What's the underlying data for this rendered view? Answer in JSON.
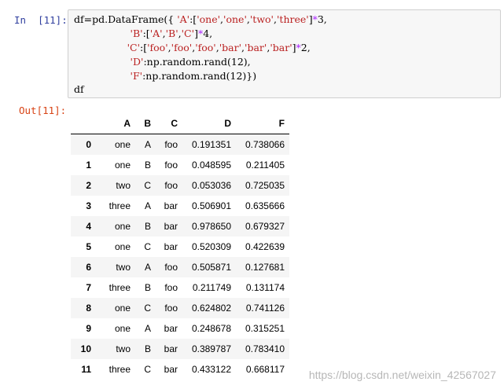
{
  "cell": {
    "in_prompt": "In  [11]:",
    "out_prompt": "Out[11]:",
    "code": [
      {
        "parts": [
          [
            "df=pd.DataFrame({ ",
            ""
          ],
          [
            "'A'",
            "str"
          ],
          [
            ":[",
            ""
          ],
          [
            "'one'",
            "str"
          ],
          [
            ",",
            ""
          ],
          [
            "'one'",
            "str"
          ],
          [
            ",",
            ""
          ],
          [
            "'two'",
            "str"
          ],
          [
            ",",
            ""
          ],
          [
            "'three'",
            "str"
          ],
          [
            "]",
            ""
          ],
          [
            "*",
            "op"
          ],
          [
            "3,",
            ""
          ]
        ]
      },
      {
        "parts": [
          [
            "                  ",
            ""
          ],
          [
            "'B'",
            "str"
          ],
          [
            ":[",
            ""
          ],
          [
            "'A'",
            "str"
          ],
          [
            ",",
            ""
          ],
          [
            "'B'",
            "str"
          ],
          [
            ",",
            ""
          ],
          [
            "'C'",
            "str"
          ],
          [
            "]",
            ""
          ],
          [
            "*",
            "op"
          ],
          [
            "4,",
            ""
          ]
        ]
      },
      {
        "parts": [
          [
            "                 ",
            ""
          ],
          [
            "'C'",
            "str"
          ],
          [
            ":[",
            ""
          ],
          [
            "'foo'",
            "str"
          ],
          [
            ",",
            ""
          ],
          [
            "'foo'",
            "str"
          ],
          [
            ",",
            ""
          ],
          [
            "'foo'",
            "str"
          ],
          [
            ",",
            ""
          ],
          [
            "'bar'",
            "str"
          ],
          [
            ",",
            ""
          ],
          [
            "'bar'",
            "str"
          ],
          [
            ",",
            ""
          ],
          [
            "'bar'",
            "str"
          ],
          [
            "]",
            ""
          ],
          [
            "*",
            "op"
          ],
          [
            "2,",
            ""
          ]
        ]
      },
      {
        "parts": [
          [
            "                  ",
            ""
          ],
          [
            "'D'",
            "str"
          ],
          [
            ":np.random.rand(12),",
            ""
          ]
        ]
      },
      {
        "parts": [
          [
            "                  ",
            ""
          ],
          [
            "'F'",
            "str"
          ],
          [
            ":np.random.rand(12)})",
            ""
          ]
        ]
      },
      {
        "parts": [
          [
            "df",
            ""
          ]
        ]
      }
    ]
  },
  "dataframe": {
    "columns": [
      "",
      "A",
      "B",
      "C",
      "D",
      "F"
    ],
    "rows": [
      [
        "0",
        "one",
        "A",
        "foo",
        "0.191351",
        "0.738066"
      ],
      [
        "1",
        "one",
        "B",
        "foo",
        "0.048595",
        "0.211405"
      ],
      [
        "2",
        "two",
        "C",
        "foo",
        "0.053036",
        "0.725035"
      ],
      [
        "3",
        "three",
        "A",
        "bar",
        "0.506901",
        "0.635666"
      ],
      [
        "4",
        "one",
        "B",
        "bar",
        "0.978650",
        "0.679327"
      ],
      [
        "5",
        "one",
        "C",
        "bar",
        "0.520309",
        "0.422639"
      ],
      [
        "6",
        "two",
        "A",
        "foo",
        "0.505871",
        "0.127681"
      ],
      [
        "7",
        "three",
        "B",
        "foo",
        "0.211749",
        "0.131174"
      ],
      [
        "8",
        "one",
        "C",
        "foo",
        "0.624802",
        "0.741126"
      ],
      [
        "9",
        "one",
        "A",
        "bar",
        "0.248678",
        "0.315251"
      ],
      [
        "10",
        "two",
        "B",
        "bar",
        "0.389787",
        "0.783410"
      ],
      [
        "11",
        "three",
        "C",
        "bar",
        "0.433122",
        "0.668117"
      ]
    ]
  },
  "watermark": "https://blog.csdn.net/weixin_42567027"
}
